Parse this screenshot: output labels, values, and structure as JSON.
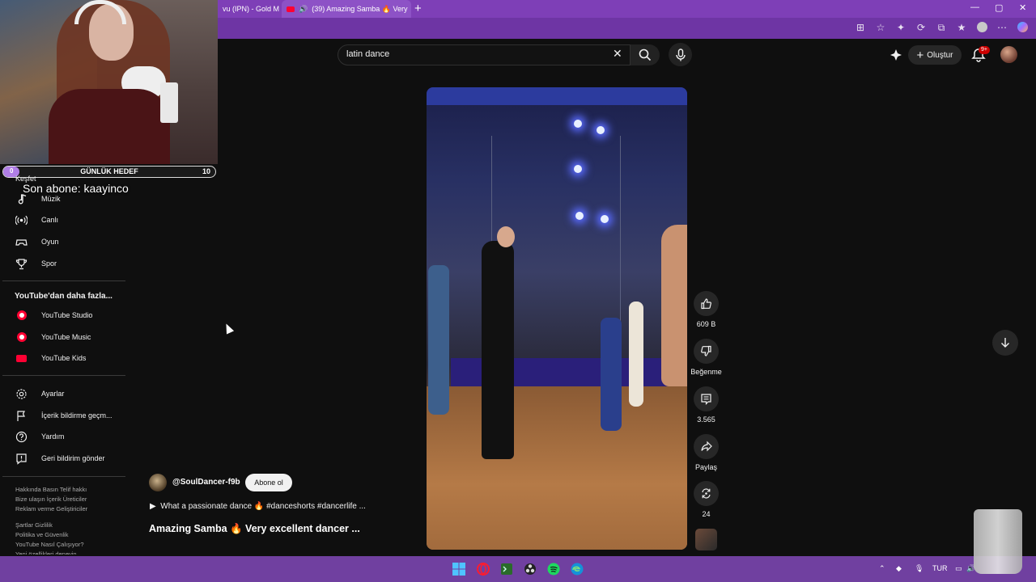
{
  "browser": {
    "tabs": [
      {
        "label": "vu (IPN) - Gold M"
      },
      {
        "label": "(39) Amazing Samba 🔥 Very"
      }
    ],
    "new_tab": "+",
    "window_controls": {
      "minimize": "—",
      "maximize": "▢",
      "close": "✕"
    },
    "accent_color": "#7e3fb7"
  },
  "search": {
    "value": "latin dance"
  },
  "masthead": {
    "create_label": "Oluştur",
    "notification_count": "9+"
  },
  "webcam": {
    "goal": {
      "start": "0",
      "title": "GÜNLÜK HEDEF",
      "end": "10",
      "progress": 0
    },
    "partial_label": "Keşfet",
    "last_subscriber": "Son abone: kaayinco"
  },
  "sidebar": {
    "explore": [
      {
        "label": "Müzik",
        "icon": "music-note-icon"
      },
      {
        "label": "Canlı",
        "icon": "live-icon"
      },
      {
        "label": "Oyun",
        "icon": "gamepad-icon"
      },
      {
        "label": "Spor",
        "icon": "trophy-icon"
      }
    ],
    "more_heading": "YouTube'dan daha fazla...",
    "more": [
      {
        "label": "YouTube Studio",
        "icon": "youtube-studio-icon"
      },
      {
        "label": "YouTube Music",
        "icon": "youtube-music-icon"
      },
      {
        "label": "YouTube Kids",
        "icon": "youtube-kids-icon"
      }
    ],
    "settings": [
      {
        "label": "Ayarlar",
        "icon": "gear-icon"
      },
      {
        "label": "İçerik bildirme geçm...",
        "icon": "flag-icon"
      },
      {
        "label": "Yardım",
        "icon": "help-icon"
      },
      {
        "label": "Geri bildirim gönder",
        "icon": "feedback-icon"
      }
    ],
    "footer": {
      "line1": "Hakkında   Basın   Telif hakkı",
      "line2": "Bize ulaşın   İçerik Üreticiler",
      "line3": "Reklam verme   Geliştiriciler",
      "line4": "Şartlar   Gizlilik",
      "line5": "Politika ve Güvenlik",
      "line6": "YouTube Nasıl Çalışıyor?",
      "line7": "Yeni özellikleri deneyin"
    }
  },
  "short": {
    "channel": "@SoulDancer-f9b",
    "subscribe_label": "Abone ol",
    "description": "What a passionate dance 🔥 #danceshorts #dancerlife ...",
    "title": "Amazing Samba 🔥 Very excellent dancer ...",
    "actions": {
      "likes": "609 B",
      "dislike": "Beğenme",
      "comments": "3.565",
      "share": "Paylaş",
      "remix": "24"
    }
  },
  "taskbar": {
    "lang": "TUR",
    "apps": [
      "windows-start-icon",
      "opera-icon",
      "terminal-icon",
      "obs-icon",
      "spotify-icon",
      "edge-icon"
    ]
  }
}
